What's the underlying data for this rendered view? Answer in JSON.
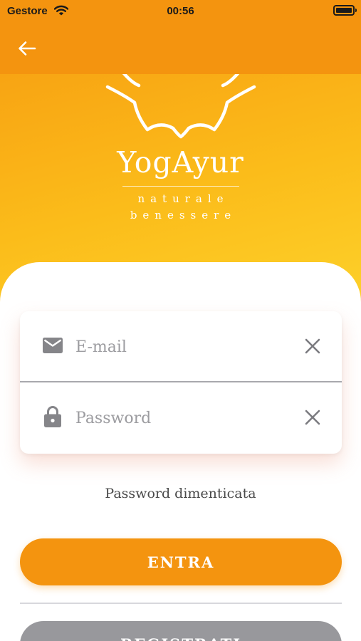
{
  "status_bar": {
    "carrier": "Gestore",
    "time": "00:56",
    "wifi_icon": "wifi-icon",
    "battery_icon": "battery-icon"
  },
  "app_bar": {
    "back_icon": "arrow-left-icon"
  },
  "brand": {
    "name": "YogAyur",
    "tagline_line1": "naturale",
    "tagline_line2": "benessere",
    "logo_icon": "lotus-logo-icon"
  },
  "login": {
    "email_icon": "mail-icon",
    "email_placeholder": "E-mail",
    "email_value": "",
    "password_icon": "lock-icon",
    "password_placeholder": "Password",
    "password_value": "",
    "clear_icon": "close-icon"
  },
  "links": {
    "forgot_password": "Password dimenticata"
  },
  "buttons": {
    "login_label": "ENTRA",
    "register_label": "REGISTRATI"
  },
  "colors": {
    "accent": "#f4940f",
    "gradient_start": "#f8a413",
    "gradient_end": "#fdd12a",
    "secondary_button": "#98989c"
  }
}
